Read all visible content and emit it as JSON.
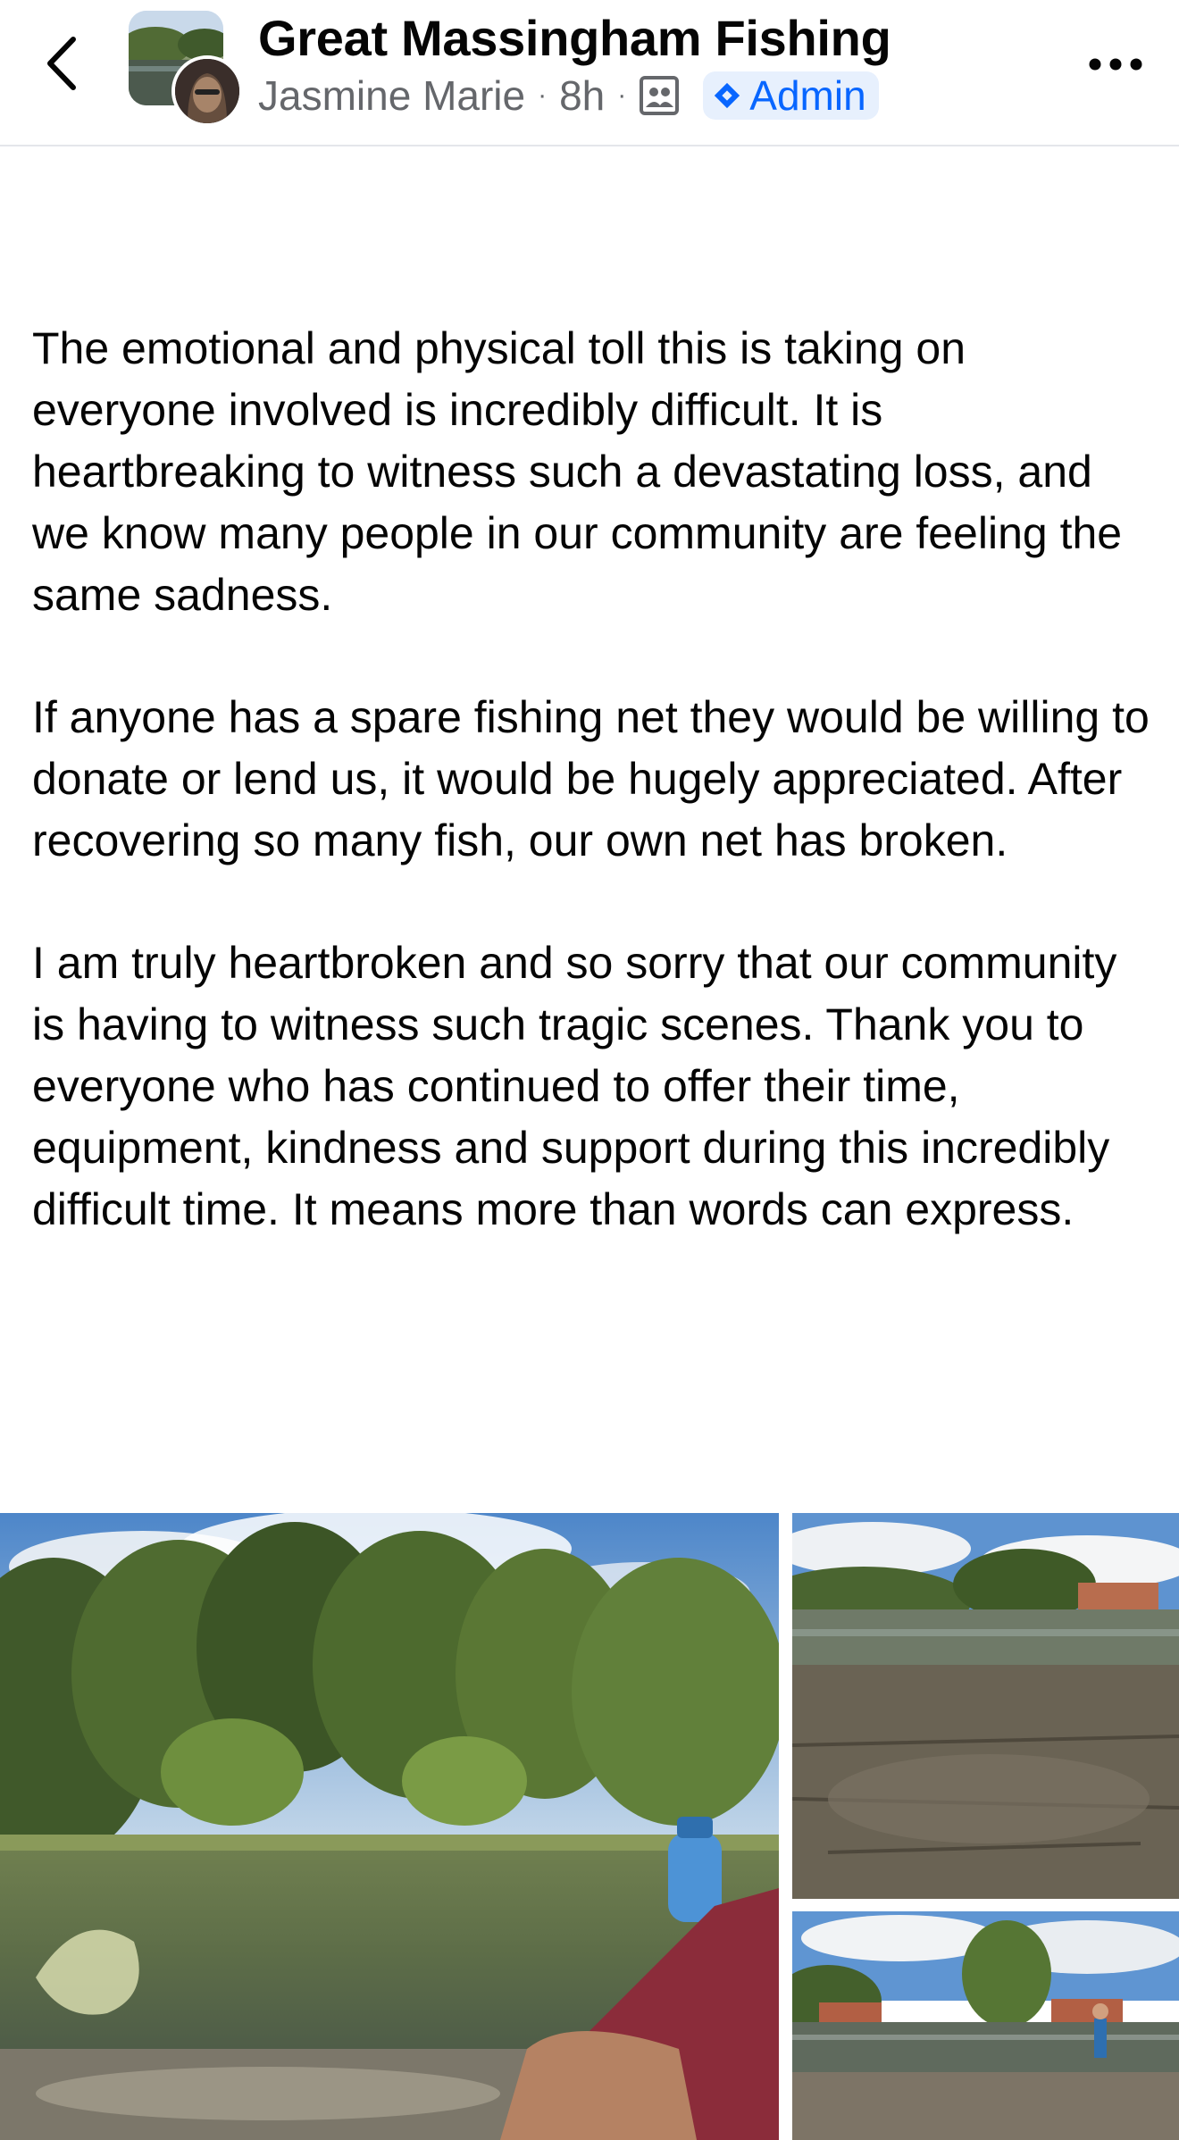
{
  "header": {
    "group_name": "Great Massingham Fishing",
    "author": "Jasmine Marie",
    "time": "8h",
    "separator": "·",
    "admin_label": "Admin",
    "accent_color": "#0866ff"
  },
  "post": {
    "paragraphs": [
      "The emotional and physical toll this is taking on everyone involved is incredibly difficult. It is heartbreaking to witness such a devastating loss, and we know many people in our community are feeling the same sadness.",
      "If anyone has a spare fishing net they would be willing to donate or lend us, it would be hugely appreciated. After recovering so many fish, our own net has broken.",
      "I am truly heartbroken and so sorry that our community is having to witness such tragic scenes. Thank you to everyone who has continued to offer their time, equipment, kindness and support during this incredibly difficult time. It means more than words can express."
    ]
  },
  "icons": {
    "back": "chevron-left-icon",
    "more": "more-options-icon",
    "members": "group-members-icon",
    "admin": "admin-diamond-icon"
  }
}
